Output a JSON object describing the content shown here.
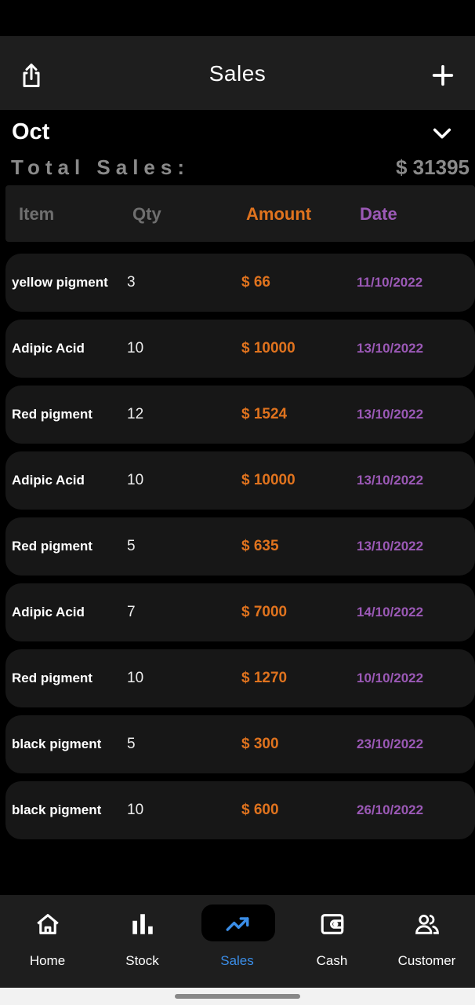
{
  "header": {
    "title": "Sales"
  },
  "month": {
    "label": "Oct"
  },
  "summary": {
    "label": "Total Sales:",
    "value": "$ 31395"
  },
  "table": {
    "columns": {
      "item": "Item",
      "qty": "Qty",
      "amount": "Amount",
      "date": "Date"
    },
    "rows": [
      {
        "item": "yellow pigment",
        "qty": "3",
        "amount": "$ 66",
        "date": "11/10/2022"
      },
      {
        "item": "Adipic Acid",
        "qty": "10",
        "amount": "$ 10000",
        "date": "13/10/2022"
      },
      {
        "item": "Red pigment",
        "qty": "12",
        "amount": "$ 1524",
        "date": "13/10/2022"
      },
      {
        "item": "Adipic Acid",
        "qty": "10",
        "amount": "$ 10000",
        "date": "13/10/2022"
      },
      {
        "item": "Red pigment",
        "qty": "5",
        "amount": "$ 635",
        "date": "13/10/2022"
      },
      {
        "item": "Adipic Acid",
        "qty": "7",
        "amount": "$ 7000",
        "date": "14/10/2022"
      },
      {
        "item": "Red pigment",
        "qty": "10",
        "amount": "$ 1270",
        "date": "10/10/2022"
      },
      {
        "item": "black pigment",
        "qty": "5",
        "amount": "$ 300",
        "date": "23/10/2022"
      },
      {
        "item": "black pigment",
        "qty": "10",
        "amount": "$ 600",
        "date": "26/10/2022"
      }
    ]
  },
  "nav": {
    "items": [
      {
        "label": "Home",
        "icon": "home-icon"
      },
      {
        "label": "Stock",
        "icon": "bar-chart-icon"
      },
      {
        "label": "Sales",
        "icon": "trending-up-icon",
        "active": true
      },
      {
        "label": "Cash",
        "icon": "wallet-icon"
      },
      {
        "label": "Customer",
        "icon": "people-icon"
      }
    ]
  },
  "colors": {
    "accent": "#3b8ee8",
    "amount": "#e0731e",
    "date": "#9b59b6"
  }
}
